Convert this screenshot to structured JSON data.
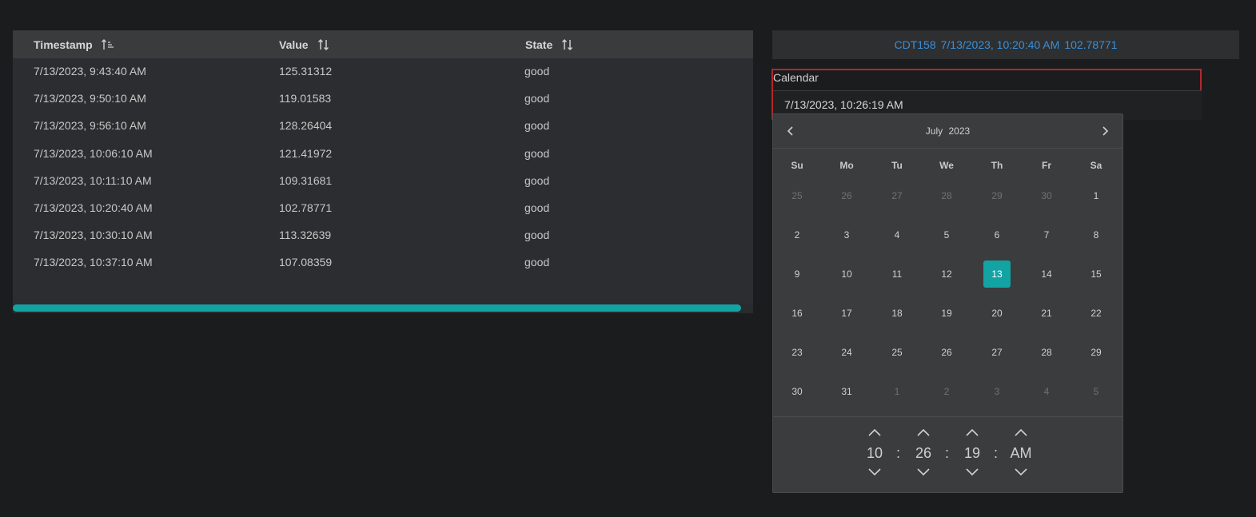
{
  "table": {
    "columns": [
      {
        "label": "Timestamp",
        "sort": "ascending"
      },
      {
        "label": "Value",
        "sort": "none"
      },
      {
        "label": "State",
        "sort": "none"
      }
    ],
    "rows": [
      {
        "timestamp": "7/13/2023, 9:43:40 AM",
        "value": "125.31312",
        "state": "good"
      },
      {
        "timestamp": "7/13/2023, 9:50:10 AM",
        "value": "119.01583",
        "state": "good"
      },
      {
        "timestamp": "7/13/2023, 9:56:10 AM",
        "value": "128.26404",
        "state": "good"
      },
      {
        "timestamp": "7/13/2023, 10:06:10 AM",
        "value": "121.41972",
        "state": "good"
      },
      {
        "timestamp": "7/13/2023, 10:11:10 AM",
        "value": "109.31681",
        "state": "good"
      },
      {
        "timestamp": "7/13/2023, 10:20:40 AM",
        "value": "102.78771",
        "state": "good"
      },
      {
        "timestamp": "7/13/2023, 10:30:10 AM",
        "value": "113.32639",
        "state": "good"
      },
      {
        "timestamp": "7/13/2023, 10:37:10 AM",
        "value": "107.08359",
        "state": "good"
      }
    ]
  },
  "info_bar": {
    "tag": "CDT158",
    "timestamp": "7/13/2023, 10:20:40 AM",
    "value": "102.78771"
  },
  "calendar": {
    "label": "Calendar",
    "input_value": "7/13/2023, 10:26:19 AM",
    "month": "July",
    "year": "2023",
    "weekdays": [
      "Su",
      "Mo",
      "Tu",
      "We",
      "Th",
      "Fr",
      "Sa"
    ],
    "weeks": [
      [
        "25",
        "26",
        "27",
        "28",
        "29",
        "30",
        "1"
      ],
      [
        "2",
        "3",
        "4",
        "5",
        "6",
        "7",
        "8"
      ],
      [
        "9",
        "10",
        "11",
        "12",
        "13",
        "14",
        "15"
      ],
      [
        "16",
        "17",
        "18",
        "19",
        "20",
        "21",
        "22"
      ],
      [
        "23",
        "24",
        "25",
        "26",
        "27",
        "28",
        "29"
      ],
      [
        "30",
        "31",
        "1",
        "2",
        "3",
        "4",
        "5"
      ]
    ],
    "selected_day": "13",
    "time": {
      "hour": "10",
      "minute": "26",
      "second": "19",
      "meridiem": "AM",
      "separator": ":"
    }
  },
  "colors": {
    "accent": "#13a3a3",
    "link": "#3a8fd8",
    "highlight_border": "#b3272a"
  }
}
